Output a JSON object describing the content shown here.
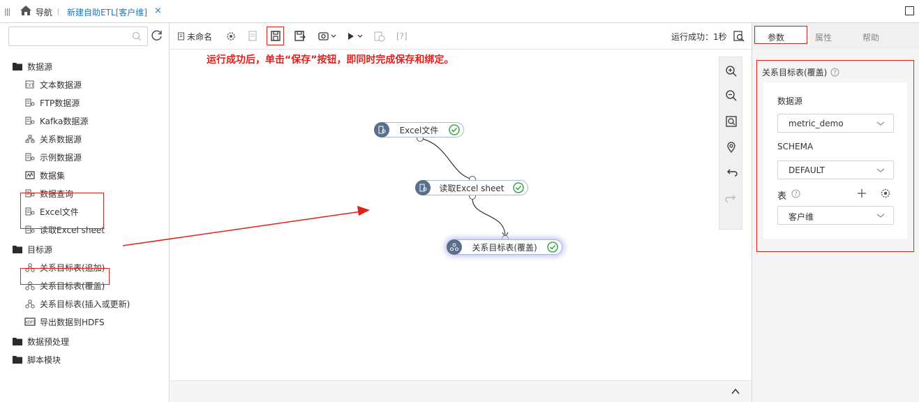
{
  "topbar": {
    "nav_label": "导航",
    "tab_title": "新建自助ETL[客户维]",
    "tab_close": "×"
  },
  "left": {
    "search_placeholder": "",
    "tree": [
      {
        "label": "数据源",
        "type": "folder"
      },
      {
        "label": "文本数据源",
        "type": "item",
        "icon": "text-datasource-icon"
      },
      {
        "label": "FTP数据源",
        "type": "item",
        "icon": "datasource-icon"
      },
      {
        "label": "Kafka数据源",
        "type": "item",
        "icon": "datasource-icon"
      },
      {
        "label": "关系数据源",
        "type": "item",
        "icon": "relational-icon"
      },
      {
        "label": "示例数据源",
        "type": "item",
        "icon": "datasource-icon"
      },
      {
        "label": "数据集",
        "type": "item",
        "icon": "dataset-icon"
      },
      {
        "label": "数据查询",
        "type": "item",
        "icon": "datasource-icon"
      },
      {
        "label": "Excel文件",
        "type": "item",
        "icon": "datasource-icon"
      },
      {
        "label": "读取Excel sheet",
        "type": "item",
        "icon": "datasource-icon"
      },
      {
        "label": "目标源",
        "type": "folder"
      },
      {
        "label": "关系目标表(追加)",
        "type": "item",
        "icon": "relational-target-icon"
      },
      {
        "label": "关系目标表(覆盖)",
        "type": "item",
        "icon": "relational-target-icon"
      },
      {
        "label": "关系目标表(插入或更新)",
        "type": "item",
        "icon": "relational-target-icon"
      },
      {
        "label": "导出数据到HDFS",
        "type": "item",
        "icon": "hdfs-icon"
      },
      {
        "label": "数据预处理",
        "type": "folder"
      },
      {
        "label": "脚本模块",
        "type": "folder"
      }
    ]
  },
  "canvas": {
    "unnamed_label": "未命名",
    "help_label": "[?]",
    "run_status": "运行成功：1秒",
    "annotation": "运行成功后，单击“保存”按钮，即同时完成保存和绑定。",
    "nodes": [
      {
        "label": "Excel文件"
      },
      {
        "label": "读取Excel sheet"
      },
      {
        "label": "关系目标表(覆盖)"
      }
    ]
  },
  "right": {
    "tabs": [
      "参数",
      "属性",
      "帮助"
    ],
    "section_title": "关系目标表(覆盖)",
    "datasource_label": "数据源",
    "datasource_value": "metric_demo",
    "schema_label": "SCHEMA",
    "schema_value": "DEFAULT",
    "table_label": "表",
    "table_value": "客户维"
  },
  "colors": {
    "accent": "#1e77c8",
    "annotation_red": "#e0201b",
    "node_icon": "#5a6f8c",
    "success_green": "#3aa64c"
  }
}
